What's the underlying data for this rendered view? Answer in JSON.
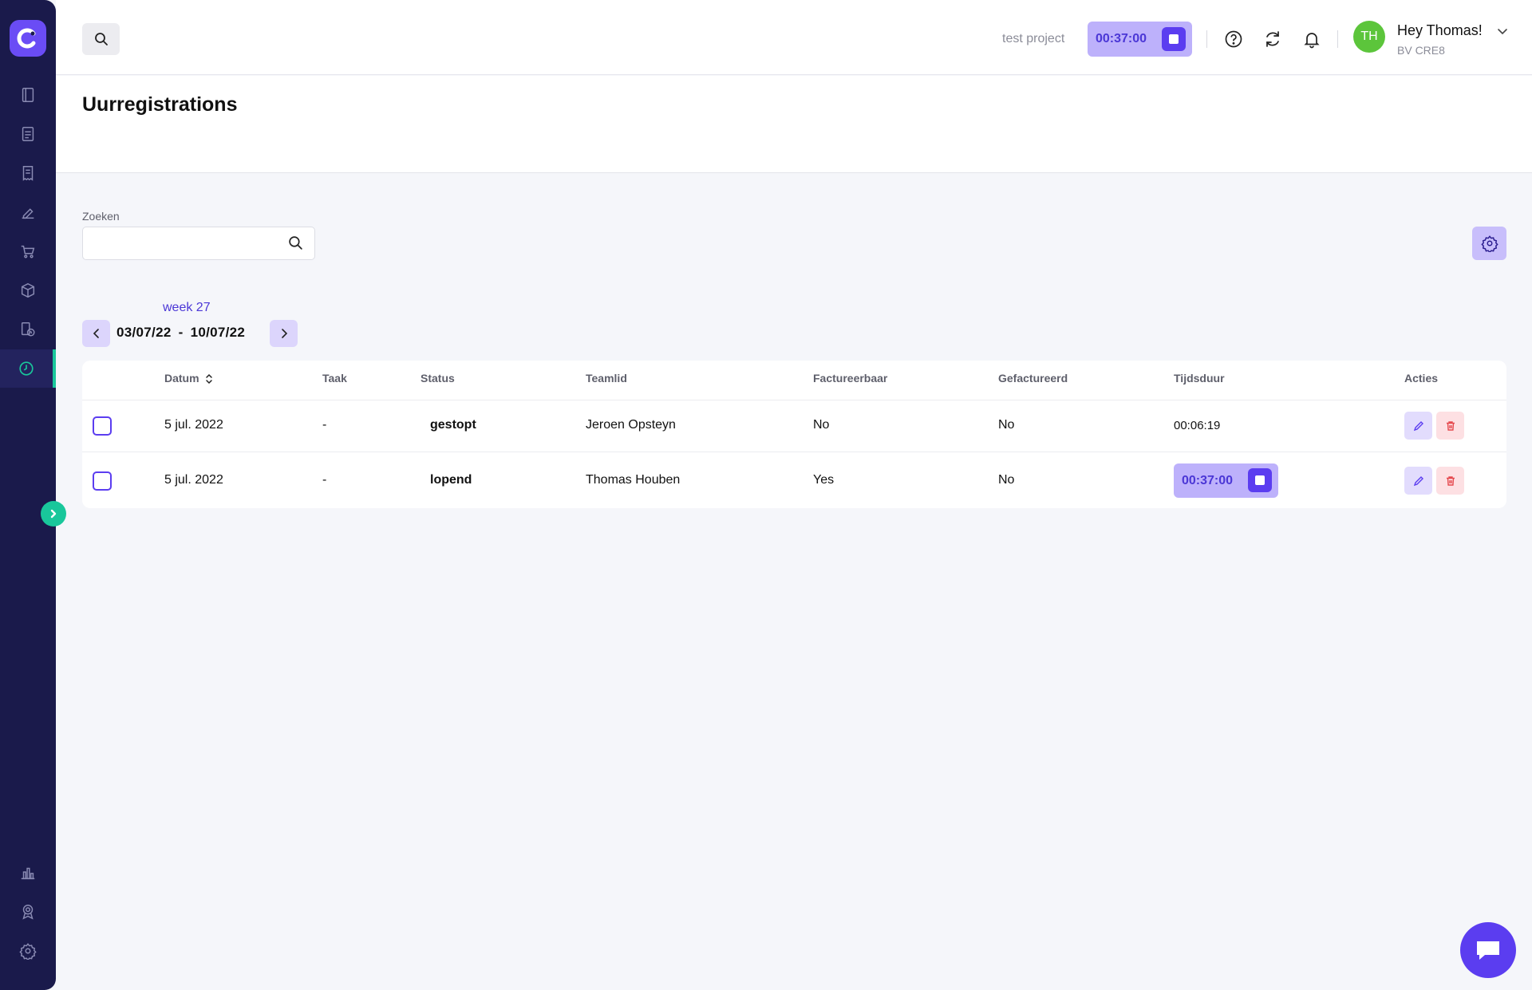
{
  "header": {
    "project_name": "test project",
    "timer": "00:37:00",
    "greeting": "Hey Thomas!",
    "company": "BV CRE8",
    "avatar_initials": "TH"
  },
  "page": {
    "title": "Uurregistrations"
  },
  "filter": {
    "search_label": "Zoeken",
    "search_value": "",
    "search_placeholder": ""
  },
  "week": {
    "label": "week 27",
    "start": "03/07/22",
    "separator": "-",
    "end": "10/07/22"
  },
  "table": {
    "headers": {
      "datum": "Datum",
      "taak": "Taak",
      "status": "Status",
      "teamlid": "Teamlid",
      "factureerbaar": "Factureerbaar",
      "gefactureerd": "Gefactureerd",
      "tijdsduur": "Tijdsduur",
      "acties": "Acties"
    },
    "rows": [
      {
        "datum": "5 jul. 2022",
        "taak": "-",
        "status": "gestopt",
        "teamlid": "Jeroen Opsteyn",
        "factureerbaar": "No",
        "gefactureerd": "No",
        "tijdsduur": "00:06:19"
      },
      {
        "datum": "5 jul. 2022",
        "taak": "-",
        "status": "lopend",
        "teamlid": "Thomas Houben",
        "factureerbaar": "Yes",
        "gefactureerd": "No",
        "tijdsduur": "00:37:00"
      }
    ]
  },
  "colors": {
    "sidebar": "#1a1a4b",
    "accent": "#5b3df0",
    "accent_light": "#bdb1fb",
    "active_indicator": "#19c79b",
    "avatar": "#5cc53b",
    "delete": "#e5484d"
  },
  "icons": {
    "sidebar": [
      "book-icon",
      "document-icon",
      "receipt-icon",
      "edit-document-icon",
      "cart-icon",
      "box-icon",
      "invoice-clock-icon",
      "clock-icon",
      "bar-chart-icon",
      "award-icon",
      "gear-icon"
    ],
    "header": [
      "search-icon",
      "stop-icon",
      "help-icon",
      "refresh-icon",
      "bell-icon",
      "chevron-down-icon"
    ]
  }
}
